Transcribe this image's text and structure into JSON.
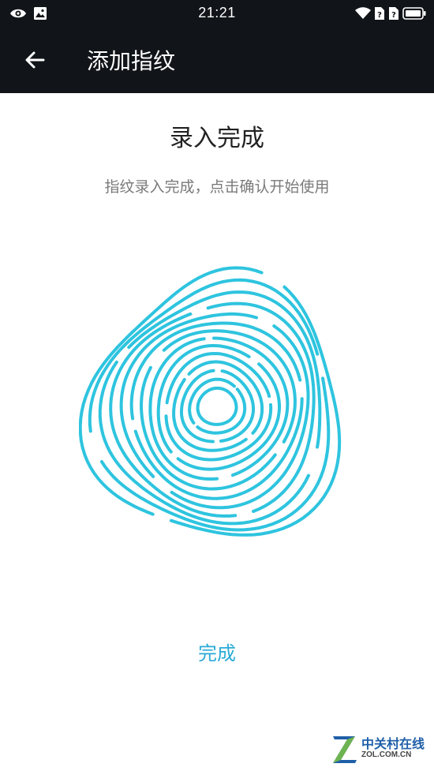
{
  "status_bar": {
    "time": "21:21",
    "left_icons": [
      "eye-icon",
      "image-icon"
    ],
    "right_icons": [
      "wifi-icon",
      "sim1-icon",
      "sim2-icon",
      "battery-icon"
    ]
  },
  "toolbar": {
    "title": "添加指纹",
    "back_icon": "arrow-left-icon"
  },
  "content": {
    "heading": "录入完成",
    "subtitle": "指纹录入完成，点击确认开始使用",
    "fingerprint_icon": "fingerprint-icon",
    "accent_color": "#2ec4df"
  },
  "actions": {
    "done_label": "完成",
    "done_color": "#2aaad6"
  },
  "watermark": {
    "text_top": "中关村在线",
    "text_bottom": "ZOL.COM.CN"
  },
  "colors": {
    "bar_background": "#111418",
    "page_background": "#ffffff"
  }
}
